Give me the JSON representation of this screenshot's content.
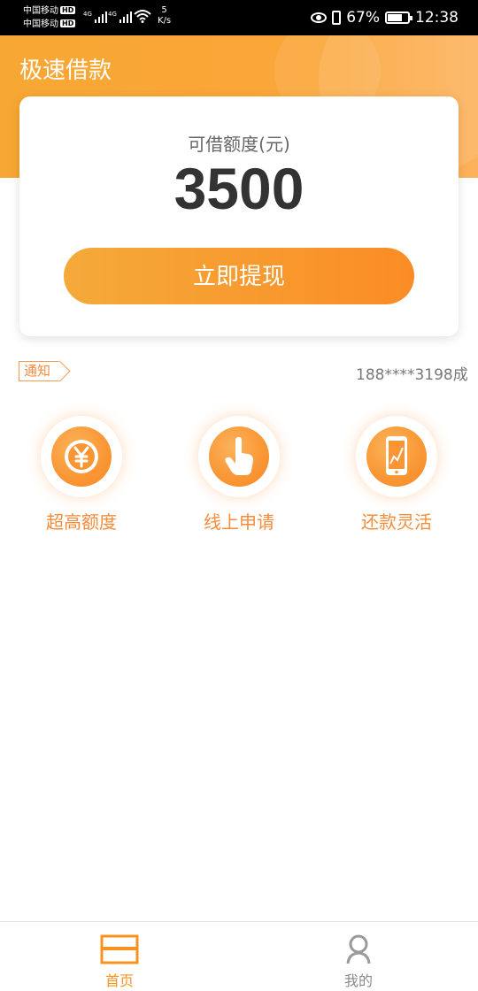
{
  "status_bar": {
    "carrier_1": "中国移动",
    "carrier_2": "中国移动",
    "hd_badge": "HD",
    "network_type": "4G",
    "speed_value": "5",
    "speed_unit": "K/s",
    "battery": "67%",
    "time": "12:38"
  },
  "header": {
    "title": "极速借款",
    "color": "#f7a733"
  },
  "loan_card": {
    "label": "可借额度(元)",
    "amount": "3500",
    "button_label": "立即提现"
  },
  "notice": {
    "tag": "通知",
    "text": "188****3198成"
  },
  "features": [
    {
      "label": "超高额度",
      "icon": "yen-coin-icon"
    },
    {
      "label": "线上申请",
      "icon": "hand-tap-icon"
    },
    {
      "label": "还款灵活",
      "icon": "phone-chart-icon"
    }
  ],
  "bottom_nav": {
    "items": [
      {
        "label": "首页",
        "icon": "home-icon",
        "active": true
      },
      {
        "label": "我的",
        "icon": "user-icon",
        "active": false
      }
    ],
    "accent": "#f7931e"
  }
}
